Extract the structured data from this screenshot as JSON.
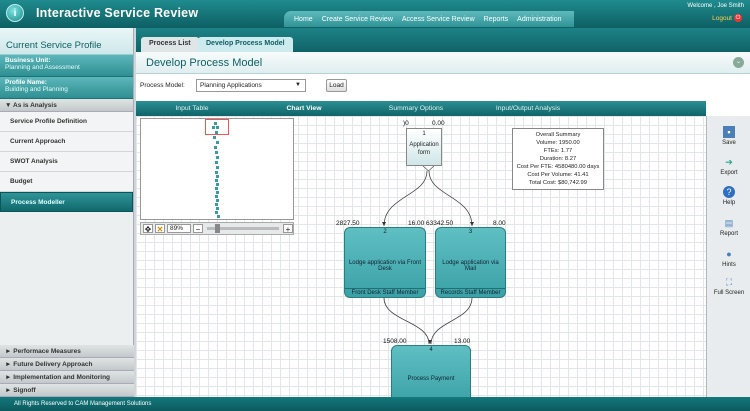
{
  "header": {
    "logo": "i",
    "title": "Interactive Service Review",
    "nav": [
      "Home",
      "Create Service Review",
      "Access Service Review",
      "Reports",
      "Administration"
    ],
    "welcome": "Welcome , Joe Smith",
    "logout": "Logout"
  },
  "sidebar": {
    "title": "Current Service Profile",
    "business_unit_label": "Business Unit:",
    "business_unit": "Planning and Assessment",
    "profile_label": "Profile Name:",
    "profile": "Building and Planning",
    "section_open": "As is Analysis",
    "items": [
      "Service Profile Definition",
      "Current Approach",
      "SWOT Analysis",
      "Budget",
      "Process Modeller"
    ],
    "collapsed": [
      "Performace Measures",
      "Future Delivery Approach",
      "Implementation and Monitoring",
      "Signoff"
    ]
  },
  "tabs": [
    "Process List",
    "Develop Process Model"
  ],
  "page_title": "Develop Process Model",
  "model": {
    "label": "Process Model:",
    "selected": "Planning Applications",
    "load": "Load"
  },
  "subtabs": [
    "Input Table",
    "Chart View",
    "Summary Options",
    "Input/Output Analysis"
  ],
  "zoom": "89%",
  "nodes": [
    {
      "num": "1",
      "label": "Application form",
      "left_val": ")0",
      "right_val": "0.00"
    },
    {
      "num": "2",
      "label": "Lodge application via Front Desk",
      "role": "Front Desk Staff Member",
      "left_val": "2827.50",
      "right_val": "16.00"
    },
    {
      "num": "3",
      "label": "Lodge application via Mail",
      "role": "Records Staff Member",
      "left_val": "63342.50",
      "right_val": "8.00"
    },
    {
      "num": "4",
      "label": "Process Payment",
      "left_val": "1508.00",
      "right_val": "13.00"
    }
  ],
  "summary": [
    "Overall Summary",
    "Volume: 1950.00",
    "FTEs: 1.77",
    "Duration: 8.27",
    "Cost Per FTE: 4580480.00 days",
    "Cost Per Volume: 41.41",
    "Total Cost: $80,742.99"
  ],
  "toolbar": [
    "Save",
    "Export",
    "Help",
    "Report",
    "Hints",
    "Full Screen"
  ],
  "footer": "All Rights Reserved to CAM Management Solutions"
}
